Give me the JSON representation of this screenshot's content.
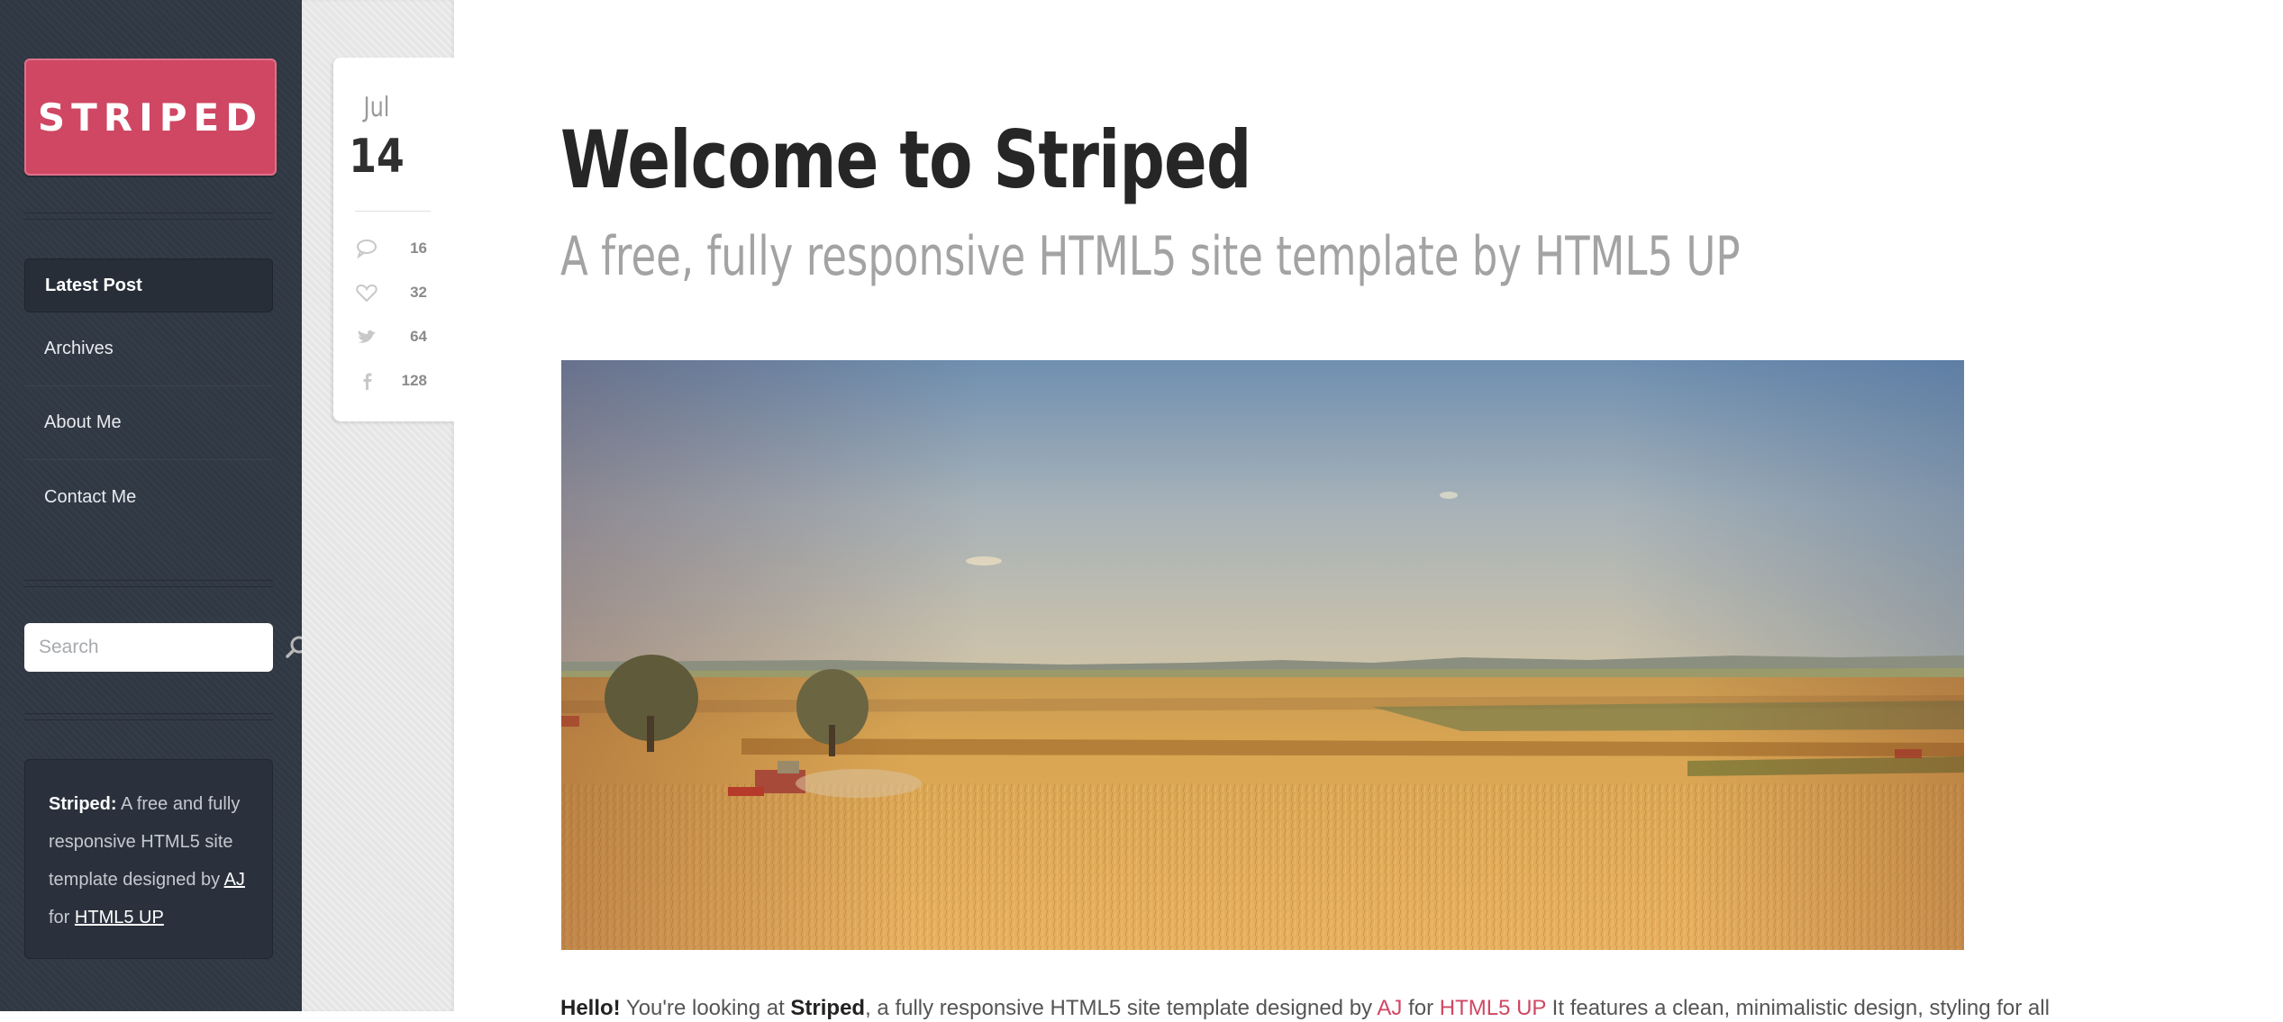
{
  "sidebar": {
    "logo": "STRIPED",
    "nav": [
      {
        "label": "Latest Post",
        "active": true
      },
      {
        "label": "Archives",
        "active": false
      },
      {
        "label": "About Me",
        "active": false
      },
      {
        "label": "Contact Me",
        "active": false
      }
    ],
    "search": {
      "placeholder": "Search",
      "icon": "search-icon"
    },
    "about": {
      "bold": "Striped:",
      "text1": " A free and fully responsive HTML5 site template designed by ",
      "link1": "AJ",
      "text2": " for ",
      "link2": "HTML5 UP"
    }
  },
  "post": {
    "month": "Jul",
    "day": "14",
    "stats": [
      {
        "icon": "comment-icon",
        "value": "16"
      },
      {
        "icon": "heart-icon",
        "value": "32"
      },
      {
        "icon": "twitter-icon",
        "value": "64"
      },
      {
        "icon": "facebook-icon",
        "value": "128"
      }
    ],
    "title": "Welcome to Striped",
    "subtitle": "A free, fully responsive HTML5 site template by HTML5 UP",
    "image_alt": "wheat field with harvester",
    "intro": {
      "hello": "Hello!",
      "t1": " You're looking at ",
      "name": "Striped",
      "t2": ", a fully responsive HTML5 site template designed by ",
      "aj": "AJ",
      "t3": " for ",
      "html5up": "HTML5 UP",
      "t4": " It features a clean, minimalistic design, styling for all"
    }
  },
  "colors": {
    "accent": "#cf4763",
    "sidebar_bg": "#303844",
    "gutter_bg": "#e6e6e6"
  }
}
